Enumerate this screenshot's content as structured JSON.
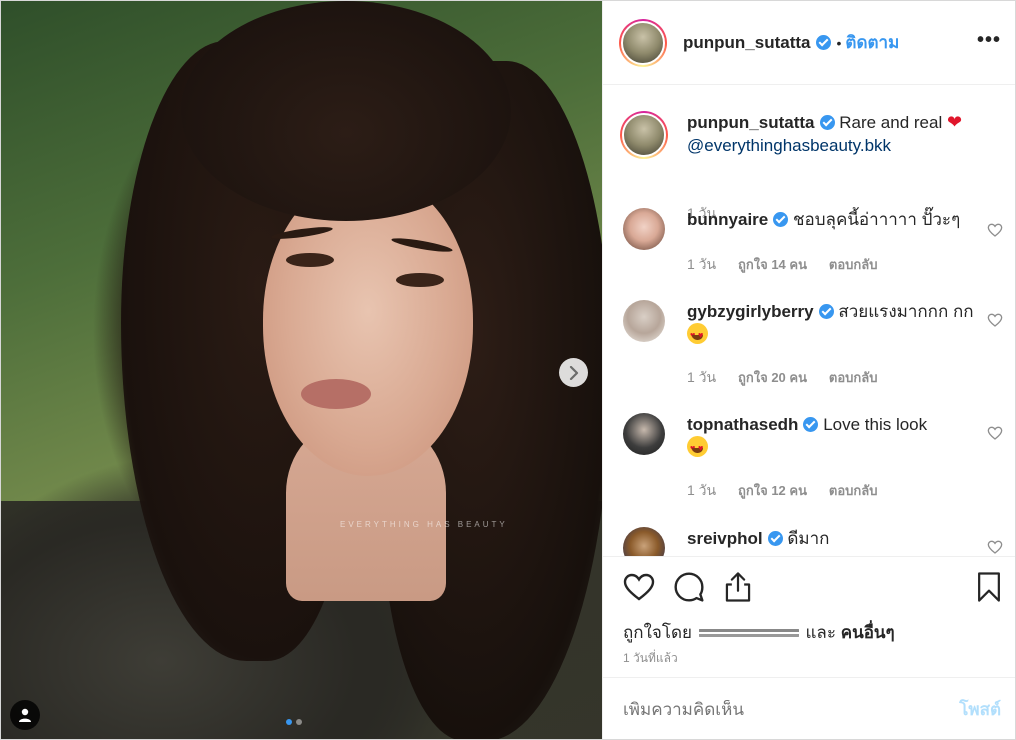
{
  "post": {
    "watermark": "EVERYTHING HAS BEAUTY",
    "carousel_dots": 2,
    "carousel_active_index": 0
  },
  "header": {
    "username": "punpun_sutatta",
    "separator": "•",
    "follow_label": "ติดตาม",
    "more_label": "•••"
  },
  "caption": {
    "username": "punpun_sutatta",
    "text": "Rare and real",
    "mention": "@everythinghasbeauty.bkk",
    "time": "1 วัน"
  },
  "comments": [
    {
      "username": "bunnyaire",
      "text": "ชอบลุคนี้อ่าาาาา ปั๊วะๆ",
      "time": "1 วัน",
      "likes": "ถูกใจ 14 คน",
      "reply": "ตอบกลับ"
    },
    {
      "username": "gybzygirlyberry",
      "text": "สวยแรงมากกก กก",
      "time": "1 วัน",
      "likes": "ถูกใจ 20 คน",
      "reply": "ตอบกลับ"
    },
    {
      "username": "topnathasedh",
      "text": "Love this look",
      "time": "1 วัน",
      "likes": "ถูกใจ 12 คน",
      "reply": "ตอบกลับ"
    },
    {
      "username": "sreivphol",
      "text": "ดีมาก"
    }
  ],
  "likes_line": {
    "prefix": "ถูกใจโดย",
    "middle": "และ",
    "others": "คนอื่นๆ"
  },
  "time_ago": "1 วันที่แล้ว",
  "add_comment": {
    "placeholder": "เพิ่มความคิดเห็น",
    "post_label": "โพสต์"
  },
  "colors": {
    "accent": "#3897f0",
    "link": "#003569",
    "muted": "#8e8e8e",
    "post_disabled": "#b2dffc"
  }
}
